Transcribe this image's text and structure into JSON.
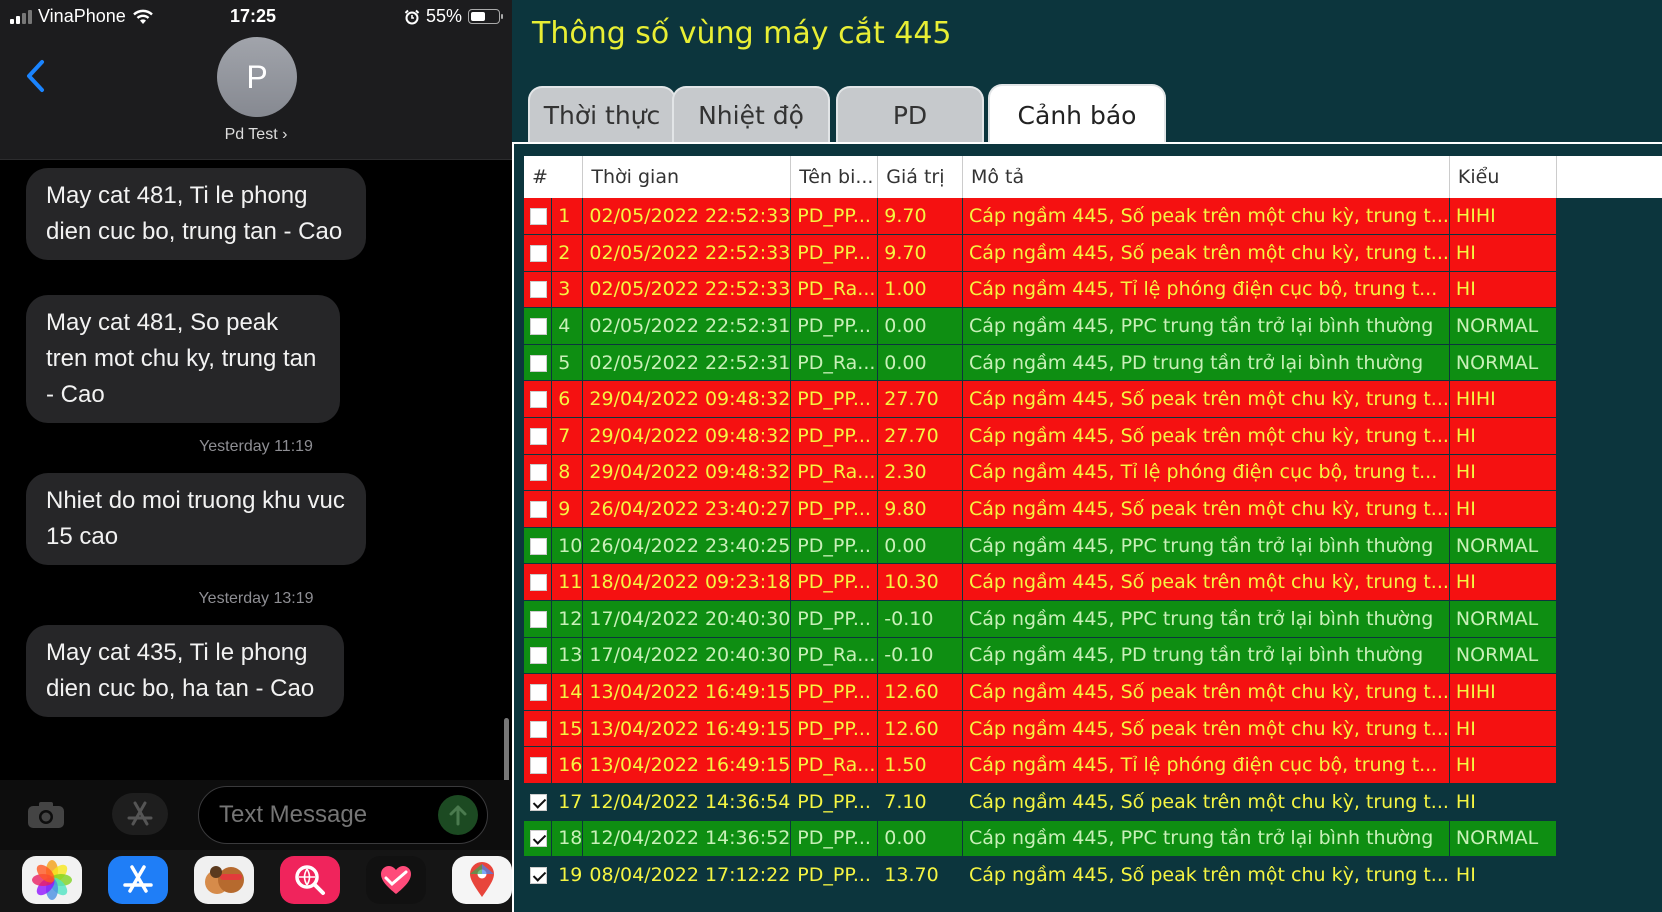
{
  "phone": {
    "status": {
      "carrier": "VinaPhone",
      "time": "17:25",
      "battery": "55%",
      "battery_level": 0.55
    },
    "contact": {
      "initial": "P",
      "name": "Pd Test ›"
    },
    "messages": [
      "May cat 481, Ti le phong dien cuc bo, trung tan - Cao",
      "May cat 481, So peak tren mot chu ky, trung tan - Cao",
      "Nhiet do moi truong khu vuc 15 cao",
      "May cat 435, Ti le phong dien cuc bo, ha tan - Cao"
    ],
    "timestamps": [
      "Yesterday 11:19",
      "Yesterday 13:19"
    ],
    "compose_placeholder": "Text Message"
  },
  "panel": {
    "title": "Thông số vùng máy cắt 445",
    "tabs": [
      "Thời thực",
      "Nhiệt độ",
      "PD",
      "Cảnh báo"
    ],
    "active_tab": "Cảnh báo",
    "columns": [
      "#",
      "Thời gian",
      "Tên bi...",
      "Giá trị",
      "Mô tả",
      "Kiểu"
    ],
    "colors": {
      "alarm": "#f51111",
      "normal": "#0e8e12",
      "title": "#e8ee34",
      "background": "#0c353d"
    },
    "rows": [
      {
        "id": "1",
        "time": "02/05/2022 22:52:33",
        "tag": "PD_PP...",
        "value": "9.70",
        "desc": "Cáp ngầm 445, Số peak trên một chu kỳ, trung t...",
        "type": "HIHI",
        "state": "alarm",
        "checked": false
      },
      {
        "id": "2",
        "time": "02/05/2022 22:52:33",
        "tag": "PD_PP...",
        "value": "9.70",
        "desc": "Cáp ngầm 445, Số peak trên một chu kỳ, trung t...",
        "type": "HI",
        "state": "alarm",
        "checked": false
      },
      {
        "id": "3",
        "time": "02/05/2022 22:52:33",
        "tag": "PD_Ra...",
        "value": "1.00",
        "desc": "Cáp ngầm 445, Tỉ lệ phóng điện cục bộ, trung t...",
        "type": "HI",
        "state": "alarm",
        "checked": false
      },
      {
        "id": "4",
        "time": "02/05/2022 22:52:31",
        "tag": "PD_PP...",
        "value": "0.00",
        "desc": "Cáp ngầm 445, PPC trung tần trở lại bình thường",
        "type": "NORMAL",
        "state": "normal",
        "checked": false
      },
      {
        "id": "5",
        "time": "02/05/2022 22:52:31",
        "tag": "PD_Ra...",
        "value": "0.00",
        "desc": "Cáp ngầm 445, PD trung tần trở lại bình thường",
        "type": "NORMAL",
        "state": "normal",
        "checked": false
      },
      {
        "id": "6",
        "time": "29/04/2022 09:48:32",
        "tag": "PD_PP...",
        "value": "27.70",
        "desc": "Cáp ngầm 445, Số peak trên một chu kỳ, trung t...",
        "type": "HIHI",
        "state": "alarm",
        "checked": false
      },
      {
        "id": "7",
        "time": "29/04/2022 09:48:32",
        "tag": "PD_PP...",
        "value": "27.70",
        "desc": "Cáp ngầm 445, Số peak trên một chu kỳ, trung t...",
        "type": "HI",
        "state": "alarm",
        "checked": false
      },
      {
        "id": "8",
        "time": "29/04/2022 09:48:32",
        "tag": "PD_Ra...",
        "value": "2.30",
        "desc": "Cáp ngầm 445, Tỉ lệ phóng điện cục bộ, trung t...",
        "type": "HI",
        "state": "alarm",
        "checked": false
      },
      {
        "id": "9",
        "time": "26/04/2022 23:40:27",
        "tag": "PD_PP...",
        "value": "9.80",
        "desc": "Cáp ngầm 445, Số peak trên một chu kỳ, trung t...",
        "type": "HI",
        "state": "alarm",
        "checked": false
      },
      {
        "id": "10",
        "time": "26/04/2022 23:40:25",
        "tag": "PD_PP...",
        "value": "0.00",
        "desc": "Cáp ngầm 445, PPC trung tần trở lại bình thường",
        "type": "NORMAL",
        "state": "normal",
        "checked": false
      },
      {
        "id": "11",
        "time": "18/04/2022 09:23:18",
        "tag": "PD_PP...",
        "value": "10.30",
        "desc": "Cáp ngầm 445, Số peak trên một chu kỳ, trung t...",
        "type": "HI",
        "state": "alarm",
        "checked": false
      },
      {
        "id": "12",
        "time": "17/04/2022 20:40:30",
        "tag": "PD_PP...",
        "value": "-0.10",
        "desc": "Cáp ngầm 445, PPC trung tần trở lại bình thường",
        "type": "NORMAL",
        "state": "normal",
        "checked": false
      },
      {
        "id": "13",
        "time": "17/04/2022 20:40:30",
        "tag": "PD_Ra...",
        "value": "-0.10",
        "desc": "Cáp ngầm 445, PD trung tần trở lại bình thường",
        "type": "NORMAL",
        "state": "normal",
        "checked": false
      },
      {
        "id": "14",
        "time": "13/04/2022 16:49:15",
        "tag": "PD_PP...",
        "value": "12.60",
        "desc": "Cáp ngầm 445, Số peak trên một chu kỳ, trung t...",
        "type": "HIHI",
        "state": "alarm",
        "checked": false
      },
      {
        "id": "15",
        "time": "13/04/2022 16:49:15",
        "tag": "PD_PP...",
        "value": "12.60",
        "desc": "Cáp ngầm 445, Số peak trên một chu kỳ, trung t...",
        "type": "HI",
        "state": "alarm",
        "checked": false
      },
      {
        "id": "16",
        "time": "13/04/2022 16:49:15",
        "tag": "PD_Ra...",
        "value": "1.50",
        "desc": "Cáp ngầm 445, Tỉ lệ phóng điện cục bộ, trung t...",
        "type": "HI",
        "state": "alarm",
        "checked": false
      },
      {
        "id": "17",
        "time": "12/04/2022 14:36:54",
        "tag": "PD_PP...",
        "value": "7.10",
        "desc": "Cáp ngầm 445, Số peak trên một chu kỳ, trung t...",
        "type": "HI",
        "state": "acked",
        "checked": true
      },
      {
        "id": "18",
        "time": "12/04/2022 14:36:52",
        "tag": "PD_PP...",
        "value": "0.00",
        "desc": "Cáp ngầm 445, PPC trung tần trở lại bình thường",
        "type": "NORMAL",
        "state": "normal",
        "checked": true
      },
      {
        "id": "19",
        "time": "08/04/2022 17:12:22",
        "tag": "PD_PP...",
        "value": "13.70",
        "desc": "Cáp ngầm 445, Số peak trên một chu kỳ, trung t...",
        "type": "HI",
        "state": "acked",
        "checked": true
      }
    ]
  }
}
